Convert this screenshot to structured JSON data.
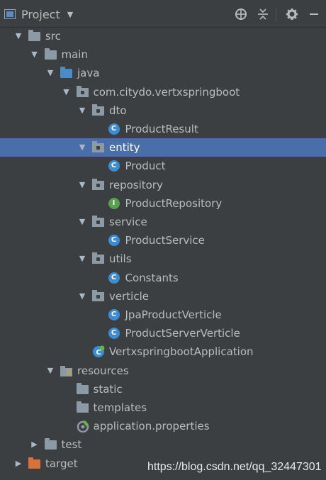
{
  "toolbar": {
    "title": "Project",
    "caret": "▼",
    "icons": [
      "target-icon",
      "collapse-icon",
      "gear-icon",
      "hide-icon"
    ]
  },
  "tree": [
    {
      "label": "src",
      "icon": "folder",
      "arrow": "▼",
      "depth": 0
    },
    {
      "label": "main",
      "icon": "folder",
      "arrow": "▼",
      "depth": 1
    },
    {
      "label": "java",
      "icon": "folder-blue",
      "arrow": "▼",
      "depth": 2
    },
    {
      "label": "com.citydo.vertxspringboot",
      "icon": "package",
      "arrow": "▼",
      "depth": 3
    },
    {
      "label": "dto",
      "icon": "package",
      "arrow": "▼",
      "depth": 4
    },
    {
      "label": "ProductResult",
      "icon": "class",
      "arrow": "",
      "depth": 5
    },
    {
      "label": "entity",
      "icon": "package",
      "arrow": "▼",
      "depth": 4,
      "selected": true
    },
    {
      "label": "Product",
      "icon": "class",
      "arrow": "",
      "depth": 5
    },
    {
      "label": "repository",
      "icon": "package",
      "arrow": "▼",
      "depth": 4
    },
    {
      "label": "ProductRepository",
      "icon": "interface",
      "arrow": "",
      "depth": 5
    },
    {
      "label": "service",
      "icon": "package",
      "arrow": "▼",
      "depth": 4
    },
    {
      "label": "ProductService",
      "icon": "class",
      "arrow": "",
      "depth": 5
    },
    {
      "label": "utils",
      "icon": "package",
      "arrow": "▼",
      "depth": 4
    },
    {
      "label": "Constants",
      "icon": "class",
      "arrow": "",
      "depth": 5
    },
    {
      "label": "verticle",
      "icon": "package",
      "arrow": "▼",
      "depth": 4
    },
    {
      "label": "JpaProductVerticle",
      "icon": "class",
      "arrow": "",
      "depth": 5
    },
    {
      "label": "ProductServerVerticle",
      "icon": "class",
      "arrow": "",
      "depth": 5
    },
    {
      "label": "VertxspringbootApplication",
      "icon": "spring-app",
      "arrow": "",
      "depth": 4
    },
    {
      "label": "resources",
      "icon": "resources",
      "arrow": "▼",
      "depth": 2
    },
    {
      "label": "static",
      "icon": "folder",
      "arrow": "",
      "depth": 3
    },
    {
      "label": "templates",
      "icon": "folder",
      "arrow": "",
      "depth": 3
    },
    {
      "label": "application.properties",
      "icon": "properties",
      "arrow": "",
      "depth": 3
    },
    {
      "label": "test",
      "icon": "folder",
      "arrow": "▶",
      "depth": 1
    },
    {
      "label": "target",
      "icon": "folder-orange",
      "arrow": "▶",
      "depth": 0
    }
  ],
  "watermark": "https://blog.csdn.net/qq_32447301",
  "colors": {
    "background": "#3c3f41",
    "selection": "#4a6ea9",
    "class_icon": "#3d8ccf",
    "interface_icon": "#5a9e4f"
  }
}
